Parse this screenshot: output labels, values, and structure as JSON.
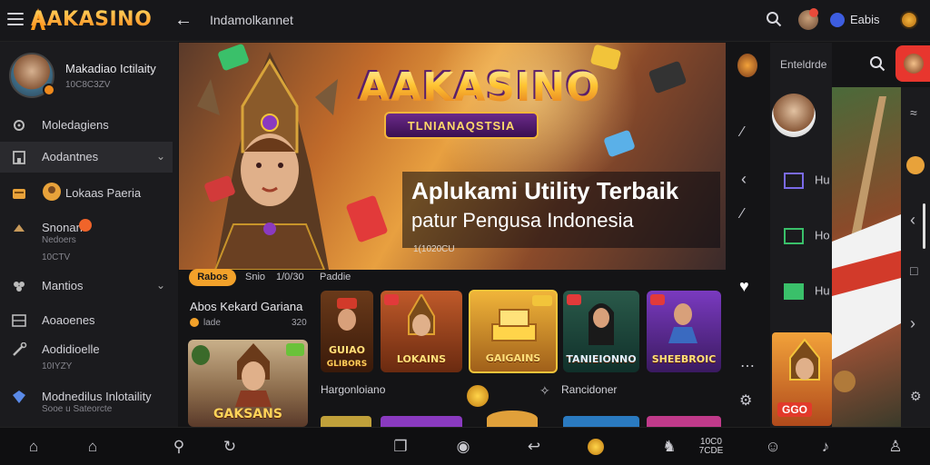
{
  "topbar": {
    "logo_text": "AAKASINO",
    "page_title": "Indamolkannet",
    "language_label": "Eabis"
  },
  "sidebar": {
    "profile": {
      "name": "Makadiao Ictilaity",
      "sub": "10C8C3ZV"
    },
    "items": [
      {
        "label": "Moledagiens",
        "sub": "",
        "icon": "gear-icon",
        "chevron": false
      },
      {
        "label": "Aodantnes",
        "sub": "",
        "icon": "building-icon",
        "chevron": true
      },
      {
        "label": "Lokaas Paeria",
        "sub": "",
        "icon": "wallet-icon",
        "chevron": false
      },
      {
        "label": "Snonan",
        "sub": "Nedoers",
        "sub2": "10CTV",
        "icon": "hand-icon",
        "chevron": false
      },
      {
        "label": "Mantios",
        "sub": "",
        "icon": "people-icon",
        "chevron": true
      },
      {
        "label": "Aoaoenes",
        "sub": "",
        "icon": "grid-icon",
        "chevron": false
      },
      {
        "label": "Aodidioelle",
        "sub": "10IYZY",
        "icon": "tool-icon",
        "chevron": false
      },
      {
        "label": "Modnedilus Inlotaility",
        "sub": "Sooe u Sateorcte",
        "icon": "gem-icon",
        "chevron": false
      }
    ]
  },
  "hero": {
    "logo": "AAKASINO",
    "ribbon": "TLNIANAQSTSIA",
    "headline": "Aplukami Utility Terbaik",
    "subheadline": "patur Pengusa Indonesia",
    "small": "1(1020CU"
  },
  "filters": {
    "active": "Rabos",
    "other": [
      "Snio",
      "1/0/30",
      "Paddie"
    ]
  },
  "sections": {
    "left_title": "Abos Kekard Gariana",
    "left_sub": "lade",
    "left_count": "320",
    "big_card_name": "GAKSANS",
    "row2_left": "Hargonloiano",
    "row2_right": "Rancidoner"
  },
  "game_cards": [
    {
      "name": "GUIAO",
      "sub": "GLIBORS"
    },
    {
      "name": "LOKAINS"
    },
    {
      "name": "GAIGAINS"
    },
    {
      "name": "TANIEIONNO"
    },
    {
      "name": "SHEEBROIC"
    }
  ],
  "right_panel": {
    "title": "Enteldrde",
    "rows": [
      "Hu",
      "Ho",
      "Hu"
    ],
    "promo_label": "GGO"
  },
  "bottom_nav": {
    "text_badge_top": "10C0",
    "text_badge_bottom": "7CDE"
  },
  "colors": {
    "accent": "#f2a12a",
    "brand_red": "#e8362e",
    "background": "#141416",
    "sidebar": "#1b1b1e"
  }
}
